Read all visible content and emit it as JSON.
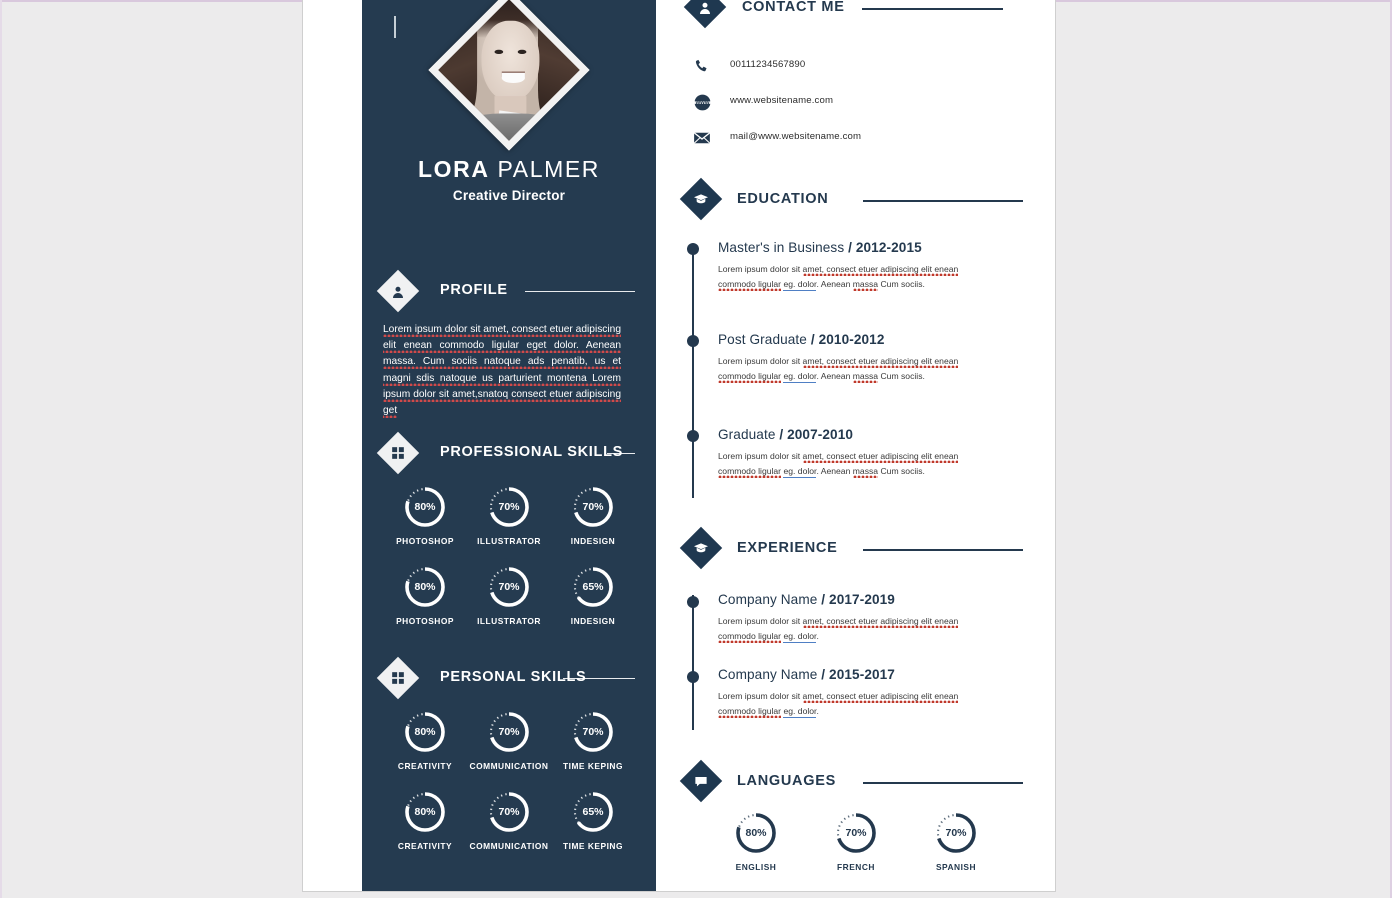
{
  "document": {
    "type": "resume",
    "background_color": "#eceaea",
    "page_color": "#ffffff",
    "accent_dark": "#253b50",
    "accent_light": "#ffffff",
    "spellcheck_red": "#c0392b",
    "spellcheck_blue": "#4f7fc4"
  },
  "header": {
    "first_name": "LORA",
    "last_name": "PALMER",
    "job_title": "Creative Director",
    "photo_alt": "portrait-photo"
  },
  "profile": {
    "heading": "PROFILE",
    "icon": "person-icon",
    "text": "Lorem ipsum dolor sit amet, consect etuer adipiscing elit enean commodo ligular eget dolor. Aenean massa. Cum sociis natoque ads penatib, us et magni sdis natoque us parturient montena Lorem ipsum dolor sit amet,snatoq consect etuer adipiscing get"
  },
  "professional_skills": {
    "heading": "PROFESSIONAL SKILLS",
    "icon": "grid-icon",
    "items": [
      {
        "label": "PHOTOSHOP",
        "percent": 80,
        "display": "80%"
      },
      {
        "label": "ILLUSTRATOR",
        "percent": 70,
        "display": "70%"
      },
      {
        "label": "INDESIGN",
        "percent": 70,
        "display": "70%"
      },
      {
        "label": "PHOTOSHOP",
        "percent": 80,
        "display": "80%"
      },
      {
        "label": "ILLUSTRATOR",
        "percent": 70,
        "display": "70%"
      },
      {
        "label": "INDESIGN",
        "percent": 65,
        "display": "65%"
      }
    ]
  },
  "personal_skills": {
    "heading": "PERSONAL SKILLS",
    "icon": "grid-icon",
    "items": [
      {
        "label": "CREATIVITY",
        "percent": 80,
        "display": "80%"
      },
      {
        "label": "COMMUNICATION",
        "percent": 70,
        "display": "70%"
      },
      {
        "label": "TIME KEPING",
        "percent": 70,
        "display": "70%"
      },
      {
        "label": "CREATIVITY",
        "percent": 80,
        "display": "80%"
      },
      {
        "label": "COMMUNICATION",
        "percent": 70,
        "display": "70%"
      },
      {
        "label": "TIME KEPING",
        "percent": 65,
        "display": "65%"
      }
    ]
  },
  "contact": {
    "heading": "CONTACT ME",
    "icon": "person-icon",
    "items": [
      {
        "icon": "phone-icon",
        "value": "00111234567890"
      },
      {
        "icon": "www-icon",
        "value": "www.websitename.com"
      },
      {
        "icon": "envelope-icon",
        "value": "mail@www.websitename.com"
      }
    ]
  },
  "education": {
    "heading": "EDUCATION",
    "icon": "graduation-cap-icon",
    "entries": [
      {
        "title": "Master's in Business",
        "separator": "/",
        "dates": "2012-2015",
        "body_1": "Lorem ipsum dolor sit ",
        "body_misspelled_1": "amet, consect etuer adipiscing elit enean commodo ligular",
        "body_link": "eg. dolor",
        "body_2": ". Aenean ",
        "body_misspelled_2": "massa",
        "body_3": " Cum sociis."
      },
      {
        "title": "Post Graduate",
        "separator": "/",
        "dates": "2010-2012",
        "body_1": "Lorem ipsum dolor sit ",
        "body_misspelled_1": "amet, consect etuer adipiscing elit enean commodo ligular",
        "body_link": "eg. dolor",
        "body_2": ". Aenean ",
        "body_misspelled_2": "massa",
        "body_3": " Cum sociis."
      },
      {
        "title": "Graduate",
        "separator": "/",
        "dates": "2007-2010",
        "body_1": "Lorem ipsum dolor sit ",
        "body_misspelled_1": "amet, consect etuer adipiscing elit enean commodo ligular",
        "body_link": "eg. dolor",
        "body_2": ". Aenean ",
        "body_misspelled_2": "massa",
        "body_3": " Cum sociis."
      }
    ]
  },
  "experience": {
    "heading": "EXPERIENCE",
    "icon": "graduation-cap-icon",
    "entries": [
      {
        "title": "Company Name",
        "separator": "/",
        "dates": "2017-2019",
        "body_1": "Lorem ipsum dolor sit ",
        "body_misspelled_1": "amet, consect etuer adipiscing elit enean commodo ligular",
        "body_link": "eg. dolor",
        "body_2": "."
      },
      {
        "title": "Company Name",
        "separator": "/",
        "dates": "2015-2017",
        "body_1": "Lorem ipsum dolor sit ",
        "body_misspelled_1": "amet, consect etuer adipiscing elit enean commodo ligular",
        "body_link": "eg. dolor",
        "body_2": "."
      }
    ]
  },
  "languages": {
    "heading": "LANGUAGES",
    "icon": "speech-bubble-icon",
    "items": [
      {
        "label": "ENGLISH",
        "percent": 80,
        "display": "80%"
      },
      {
        "label": "FRENCH",
        "percent": 70,
        "display": "70%"
      },
      {
        "label": "SPANISH",
        "percent": 70,
        "display": "70%"
      }
    ]
  }
}
